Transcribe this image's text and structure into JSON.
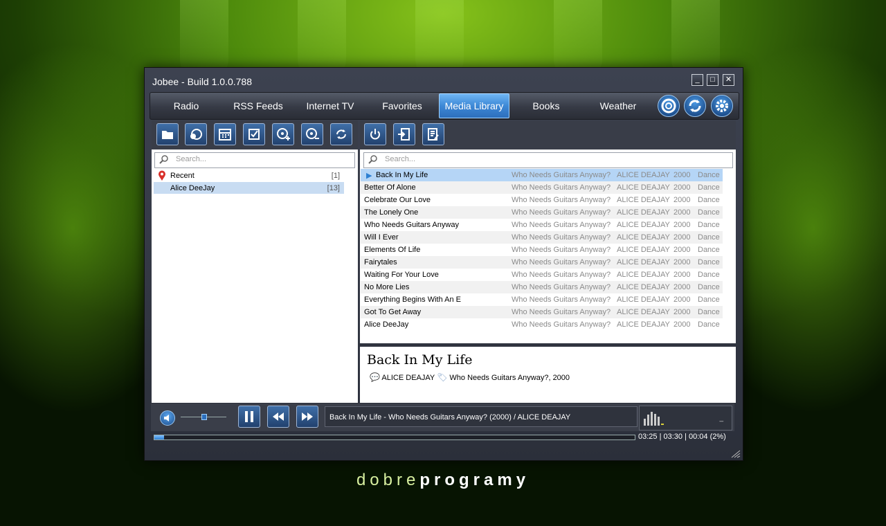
{
  "window": {
    "title": "Jobee - Build 1.0.0.788"
  },
  "window_controls": {
    "minimize": "_",
    "maximize": "□",
    "close": "✕"
  },
  "tabs": [
    {
      "label": "Radio"
    },
    {
      "label": "RSS Feeds"
    },
    {
      "label": "Internet TV"
    },
    {
      "label": "Favorites"
    },
    {
      "label": "Media Library",
      "active": true
    },
    {
      "label": "Books"
    },
    {
      "label": "Weather"
    }
  ],
  "left_search": {
    "placeholder": "Search..."
  },
  "right_search": {
    "placeholder": "Search..."
  },
  "tree": [
    {
      "label": "Recent",
      "count": "[1]",
      "icon": "map-pin-icon"
    },
    {
      "label": "Alice DeeJay",
      "count": "[13]",
      "selected": true
    }
  ],
  "tracks": [
    {
      "title": "Back In My Life",
      "album": "Who Needs Guitars Anyway?",
      "artist": "ALICE DEAJAY",
      "year": "2000",
      "genre": "Dance"
    },
    {
      "title": "Better Of Alone",
      "album": "Who Needs Guitars Anyway?",
      "artist": "ALICE DEAJAY",
      "year": "2000",
      "genre": "Dance"
    },
    {
      "title": "Celebrate Our Love",
      "album": "Who Needs Guitars Anyway?",
      "artist": "ALICE DEAJAY",
      "year": "2000",
      "genre": "Dance"
    },
    {
      "title": "The Lonely One",
      "album": "Who Needs Guitars Anyway?",
      "artist": "ALICE DEAJAY",
      "year": "2000",
      "genre": "Dance"
    },
    {
      "title": "Who Needs Guitars Anyway",
      "album": "Who Needs Guitars Anyway?",
      "artist": "ALICE DEAJAY",
      "year": "2000",
      "genre": "Dance"
    },
    {
      "title": "Will I Ever",
      "album": "Who Needs Guitars Anyway?",
      "artist": "ALICE DEAJAY",
      "year": "2000",
      "genre": "Dance"
    },
    {
      "title": "Elements Of Life",
      "album": "Who Needs Guitars Anyway?",
      "artist": "ALICE DEAJAY",
      "year": "2000",
      "genre": "Dance"
    },
    {
      "title": "Fairytales",
      "album": "Who Needs Guitars Anyway?",
      "artist": "ALICE DEAJAY",
      "year": "2000",
      "genre": "Dance"
    },
    {
      "title": "Waiting For Your Love",
      "album": "Who Needs Guitars Anyway?",
      "artist": "ALICE DEAJAY",
      "year": "2000",
      "genre": "Dance"
    },
    {
      "title": "No More Lies",
      "album": "Who Needs Guitars Anyway?",
      "artist": "ALICE DEAJAY",
      "year": "2000",
      "genre": "Dance"
    },
    {
      "title": "Everything Begins With An E",
      "album": "Who Needs Guitars Anyway?",
      "artist": "ALICE DEAJAY",
      "year": "2000",
      "genre": "Dance"
    },
    {
      "title": "Got To Get Away",
      "album": "Who Needs Guitars Anyway?",
      "artist": "ALICE DEAJAY",
      "year": "2000",
      "genre": "Dance"
    },
    {
      "title": "Alice DeeJay",
      "album": "Who Needs Guitars Anyway?",
      "artist": "ALICE DEAJAY",
      "year": "2000",
      "genre": "Dance"
    }
  ],
  "selected_track_index": 0,
  "details": {
    "title": "Back In My Life",
    "artist": "ALICE DEAJAY",
    "album_year": "Who Needs Guitars Anyway?, 2000"
  },
  "player": {
    "now_playing": "Back In My Life - Who Needs Guitars Anyway? (2000)  / ALICE DEAJAY",
    "volume": 0.5,
    "progress": 0.02,
    "time": "03:25 | 03:30 | 00:04 (2%)",
    "viz_marker": "_"
  },
  "brand": {
    "part1": "dobre",
    "part2": "programy"
  },
  "colors": {
    "accent": "#3d88d6",
    "selection": "#b5d5f6"
  }
}
